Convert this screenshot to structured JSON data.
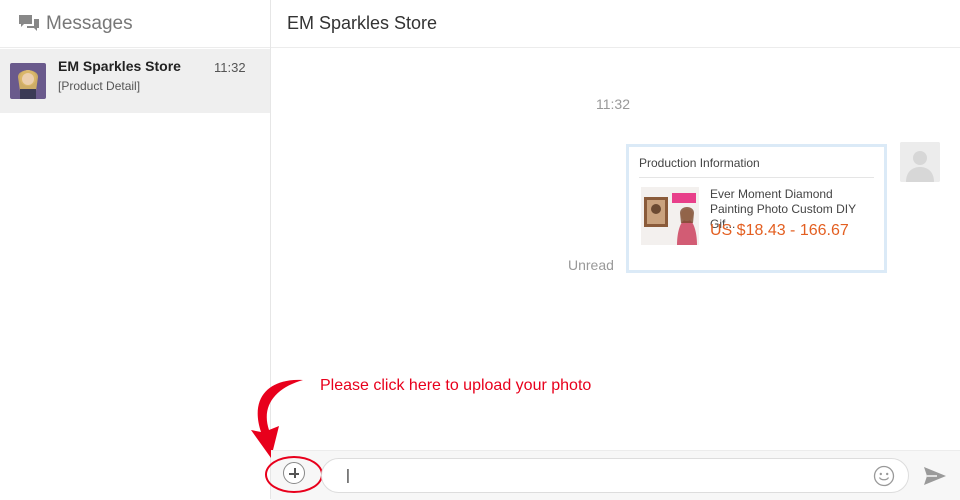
{
  "sidebar": {
    "title": "Messages",
    "title_icon": "chat-bubbles-icon",
    "conversations": [
      {
        "name": "EM Sparkles Store",
        "time": "11:32",
        "preview": "[Product Detail]"
      }
    ]
  },
  "chat": {
    "title": "EM Sparkles Store",
    "timestamp": "11:32",
    "status": "Unread",
    "card": {
      "title": "Production Information",
      "product_name": "Ever Moment Diamond Painting Photo Custom DIY Gif...",
      "price": "US $18.43 - 166.67"
    }
  },
  "annotation": {
    "text": "Please click here to upload your photo",
    "color": "#e8001c"
  },
  "composer": {
    "value": "|",
    "icons": [
      "plus-icon",
      "emoji-icon",
      "send-icon"
    ]
  },
  "colors": {
    "price": "#e35f21",
    "accent_border": "#dbeaf7"
  }
}
